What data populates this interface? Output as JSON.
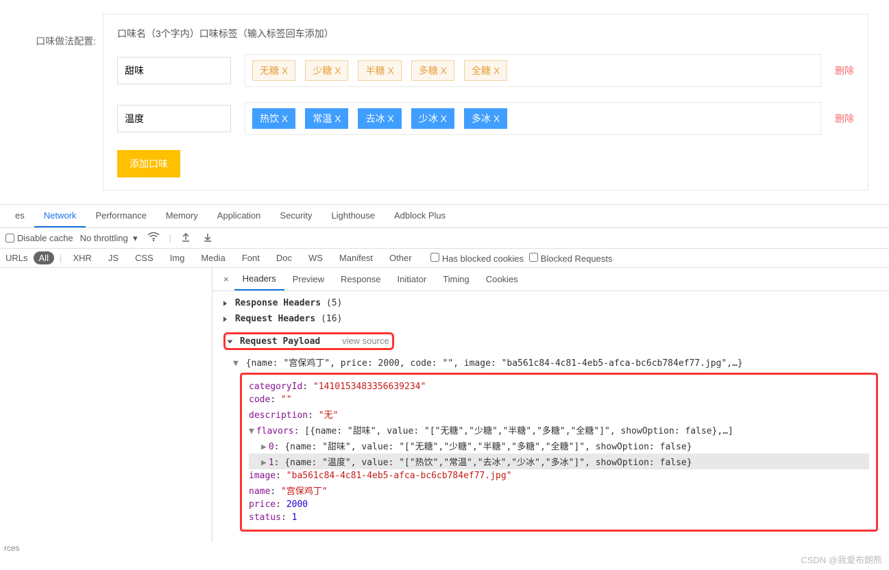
{
  "form": {
    "label": "口味做法配置:",
    "hint": "口味名（3个字内）口味标签（输入标签回车添加）",
    "rows": [
      {
        "name": "甜味",
        "tagStyle": "orange",
        "tags": [
          "无糖 X",
          "少糖 X",
          "半糖 X",
          "多糖 X",
          "全糖 X"
        ]
      },
      {
        "name": "温度",
        "tagStyle": "blue",
        "tags": [
          "热饮 X",
          "常温 X",
          "去冰 X",
          "少冰 X",
          "多冰 X"
        ]
      }
    ],
    "deleteLabel": "删除",
    "addBtn": "添加口味"
  },
  "devtools": {
    "tabs": [
      "es",
      "Network",
      "Performance",
      "Memory",
      "Application",
      "Security",
      "Lighthouse",
      "Adblock Plus"
    ],
    "activeTab": "Network",
    "toolbar": {
      "disableCache": "Disable cache",
      "throttling": "No throttling"
    },
    "filters": {
      "urls": "URLs",
      "items": [
        "All",
        "XHR",
        "JS",
        "CSS",
        "Img",
        "Media",
        "Font",
        "Doc",
        "WS",
        "Manifest",
        "Other"
      ],
      "active": "All",
      "hasBlocked": "Has blocked cookies",
      "blockedReq": "Blocked Requests"
    },
    "subtabs": [
      "Headers",
      "Preview",
      "Response",
      "Initiator",
      "Timing",
      "Cookies"
    ],
    "activeSubtab": "Headers",
    "sections": {
      "respHeaders": "Response Headers",
      "respCount": "(5)",
      "reqHeaders": "Request Headers",
      "reqCount": "(16)",
      "payload": "Request Payload",
      "viewSource": "view source"
    },
    "payload": {
      "topLine": "{name: \"宫保鸡丁\", price: 2000, code: \"\", image: \"ba561c84-4c81-4eb5-afca-bc6cb784ef77.jpg\",…}",
      "categoryId": "\"1410153483356639234\"",
      "code": "\"\"",
      "description": "\"无\"",
      "flavorsSummary": "[{name: \"甜味\", value: \"[\"无糖\",\"少糖\",\"半糖\",\"多糖\",\"全糖\"]\", showOption: false},…]",
      "flavor0": "{name: \"甜味\", value: \"[\"无糖\",\"少糖\",\"半糖\",\"多糖\",\"全糖\"]\", showOption: false}",
      "flavor1": "{name: \"温度\", value: \"[\"热饮\",\"常温\",\"去冰\",\"少冰\",\"多冰\"]\", showOption: false}",
      "image": "\"ba561c84-4c81-4eb5-afca-bc6cb784ef77.jpg\"",
      "name": "\"宫保鸡丁\"",
      "price": "2000",
      "status": "1"
    },
    "leftBottom": "rces"
  },
  "watermark": "CSDN @我爱布朗熊"
}
